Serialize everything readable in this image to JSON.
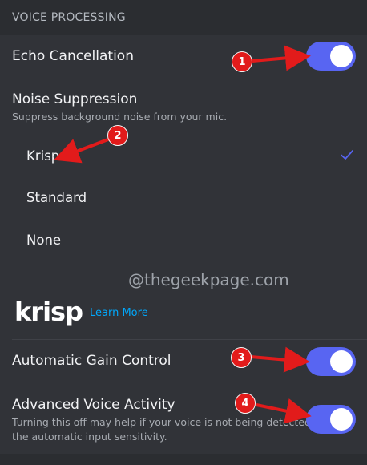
{
  "section": {
    "title": "VOICE PROCESSING"
  },
  "echo": {
    "label": "Echo Cancellation",
    "enabled": true
  },
  "noise": {
    "label": "Noise Suppression",
    "description": "Suppress background noise from your mic.",
    "options": [
      "Krisp",
      "Standard",
      "None"
    ],
    "selected": "Krisp"
  },
  "watermark": "@thegeekpage.com",
  "krisp": {
    "logo_text": "krisp",
    "learn_more": "Learn More"
  },
  "agc": {
    "label": "Automatic Gain Control",
    "enabled": true
  },
  "ava": {
    "label": "Advanced Voice Activity",
    "description_line1": "Turning this off may help if your voice is not being detected by",
    "description_line2": "the automatic input sensitivity.",
    "enabled": true
  },
  "annotations": [
    "1",
    "2",
    "3",
    "4"
  ],
  "colors": {
    "accent": "#5865f2",
    "annotation": "#e21b1b",
    "link": "#00a8fc",
    "background": "#313338"
  }
}
